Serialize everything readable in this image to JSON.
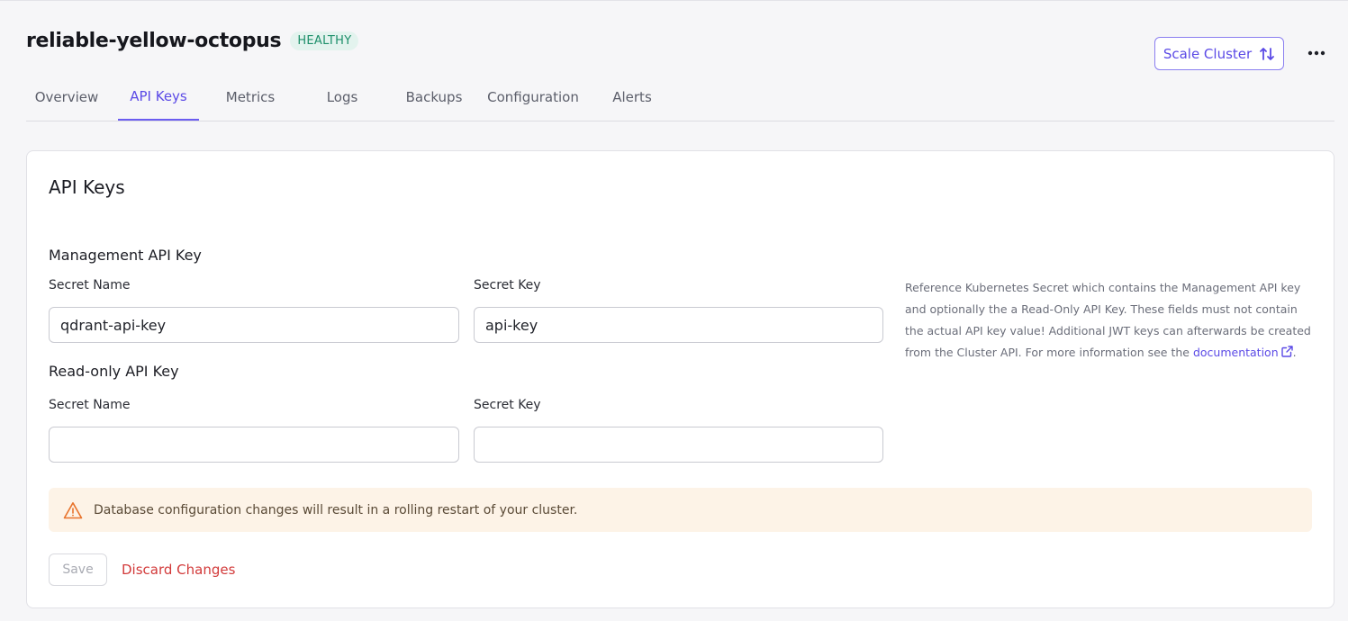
{
  "cluster": {
    "name": "reliable-yellow-octopus",
    "status": "HEALTHY"
  },
  "actions": {
    "scale_label": "Scale Cluster",
    "scale_icon": "arrows-up-down-icon",
    "more_icon": "more-horizontal-icon"
  },
  "tabs": [
    {
      "label": "Overview",
      "active": false
    },
    {
      "label": "API Keys",
      "active": true
    },
    {
      "label": "Metrics",
      "active": false
    },
    {
      "label": "Logs",
      "active": false
    },
    {
      "label": "Backups",
      "active": false
    },
    {
      "label": "Configuration",
      "active": false
    },
    {
      "label": "Alerts",
      "active": false
    }
  ],
  "card": {
    "title": "API Keys",
    "management": {
      "title": "Management API Key",
      "secret_name_label": "Secret Name",
      "secret_name_value": "qdrant-api-key",
      "secret_key_label": "Secret Key",
      "secret_key_value": "api-key"
    },
    "readonly": {
      "title": "Read-only API Key",
      "secret_name_label": "Secret Name",
      "secret_name_value": "",
      "secret_key_label": "Secret Key",
      "secret_key_value": ""
    },
    "help": {
      "text": "Reference Kubernetes Secret which contains the Management API key and optionally the a Read-Only API Key. These fields must not contain the actual API key value! Additional JWT keys can afterwards be created from the Cluster API. For more information see the ",
      "link_label": "documentation",
      "suffix": "."
    },
    "warning": "Database configuration changes will result in a rolling restart of your cluster.",
    "save_label": "Save",
    "discard_label": "Discard Changes"
  },
  "colors": {
    "accent": "#5b4ae6",
    "healthy": "#1d8f6a",
    "warning_bg": "#fdf3e7",
    "warning_icon": "#e8732c",
    "danger": "#d23a3a"
  }
}
